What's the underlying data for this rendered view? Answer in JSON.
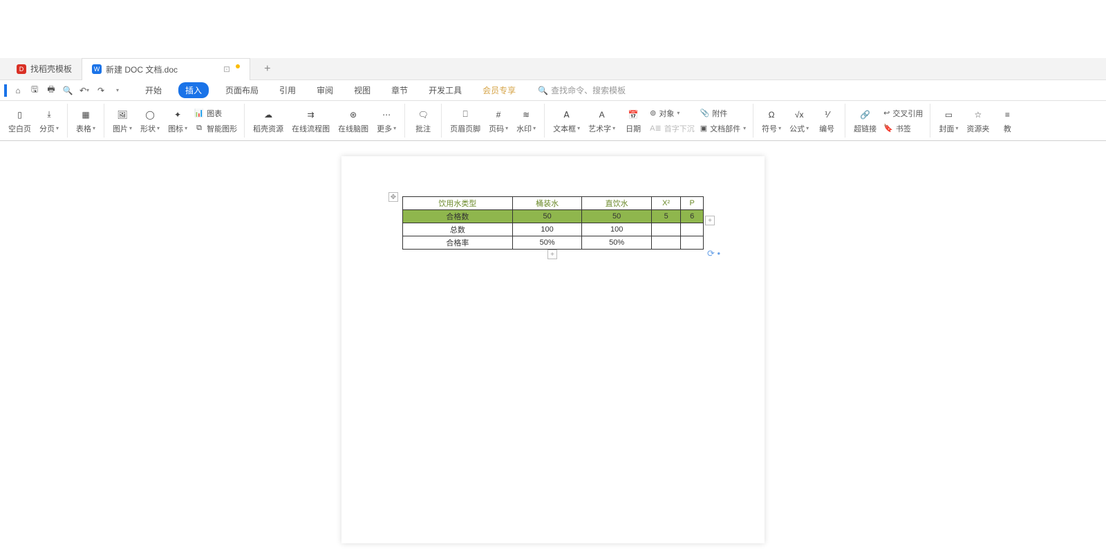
{
  "tabs": {
    "items": [
      {
        "label": "找稻壳模板",
        "icon": "D"
      },
      {
        "label": "新建 DOC 文档.doc",
        "icon": "W"
      }
    ],
    "new_tab": "+"
  },
  "menu": {
    "items": [
      "开始",
      "插入",
      "页面布局",
      "引用",
      "审阅",
      "视图",
      "章节",
      "开发工具",
      "会员专享"
    ],
    "active_index": 1,
    "search_placeholder": "查找命令、搜索模板"
  },
  "ribbon": {
    "blank_page": "空白页",
    "page_break": "分页",
    "table": "表格",
    "picture": "图片",
    "shapes": "形状",
    "icons": "图标",
    "chart": "图表",
    "smart_art": "智能图形",
    "docer_res": "稻壳资源",
    "online_flow": "在线流程图",
    "online_mind": "在线脑图",
    "more": "更多",
    "comment": "批注",
    "header_footer": "页眉页脚",
    "page_number": "页码",
    "watermark": "水印",
    "textbox": "文本框",
    "wordart": "艺术字",
    "date": "日期",
    "object": "对象",
    "drop_cap": "首字下沉",
    "attachment": "附件",
    "doc_parts": "文档部件",
    "symbol": "符号",
    "equation": "公式",
    "number": "编号",
    "hyperlink": "超链接",
    "cross_ref": "交叉引用",
    "bookmark": "书签",
    "cover": "封面",
    "resource": "资源夹",
    "edu": "教"
  },
  "doc_table": {
    "headers": [
      "饮用水类型",
      "桶装水",
      "直饮水",
      "X²",
      "P"
    ],
    "rows": [
      {
        "cells": [
          "合格数",
          "50",
          "50",
          "5",
          "6"
        ],
        "highlight": true
      },
      {
        "cells": [
          "总数",
          "100",
          "100",
          "",
          ""
        ]
      },
      {
        "cells": [
          "合格率",
          "50%",
          "50%",
          "",
          ""
        ]
      }
    ]
  }
}
